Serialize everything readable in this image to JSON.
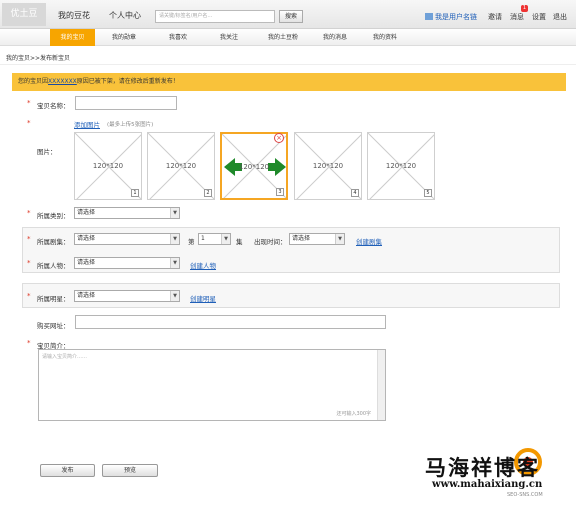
{
  "header": {
    "logo": "优土豆",
    "nav": [
      "我的豆花",
      "个人中心"
    ],
    "search_placeholder": "请关键/标签名/用户名…",
    "search_button": "搜索",
    "user_link": "我是用户名链",
    "links": [
      "邀请",
      "消息",
      "设置",
      "退出"
    ],
    "message_badge": "1"
  },
  "subnav": {
    "tabs": [
      "我的宝贝",
      "我的勋章",
      "我喜欢",
      "我关注",
      "我的土豆粉",
      "我的消息",
      "我的资料"
    ],
    "active_index": 0
  },
  "breadcrumb": "我的宝贝>>发布新宝贝",
  "alert": {
    "prefix": "您的宝贝因",
    "link": "XXXXXXX",
    "suffix": "原因已被下架，请在修改后重新发布！"
  },
  "form": {
    "name_label": "宝贝名称：",
    "add_image_link": "添加图片",
    "add_image_hint": "(最多上传5张图片)",
    "images_label": "图片：",
    "thumbnails": [
      {
        "text": "120*120",
        "num": "1"
      },
      {
        "text": "120*120",
        "num": "2"
      },
      {
        "text": "120*120",
        "num": "3"
      },
      {
        "text": "120*120",
        "num": "4"
      },
      {
        "text": "120*120",
        "num": "5"
      }
    ],
    "category_label": "所属类别：",
    "category_value": "请选择",
    "drama_label": "所属剧集：",
    "drama_value": "请选择",
    "episode_prefix": "第",
    "episode_value": "1",
    "episode_suffix": "集",
    "appear_time_label": "出现时间：",
    "appear_time_value": "请选择",
    "create_drama": "创建剧集",
    "character_label": "所属人物：",
    "character_value": "请选择",
    "create_character": "创建人物",
    "star_label": "所属明星：",
    "star_value": "请选择",
    "create_star": "创建明星",
    "buy_url_label": "购买网址：",
    "intro_label": "宝贝简介：",
    "intro_placeholder": "请输入宝贝简介……",
    "intro_counter": "还可输入300字",
    "publish_button": "发布",
    "preview_button": "预览"
  },
  "watermark": {
    "title": "马海祥博客",
    "url": "www.mahaixiang.cn",
    "sub": "SEO-SNS.COM"
  },
  "colors": {
    "accent": "#f7a500",
    "alert_bg": "#f9c23a",
    "link": "#1f5fb8",
    "required": "#d32"
  }
}
